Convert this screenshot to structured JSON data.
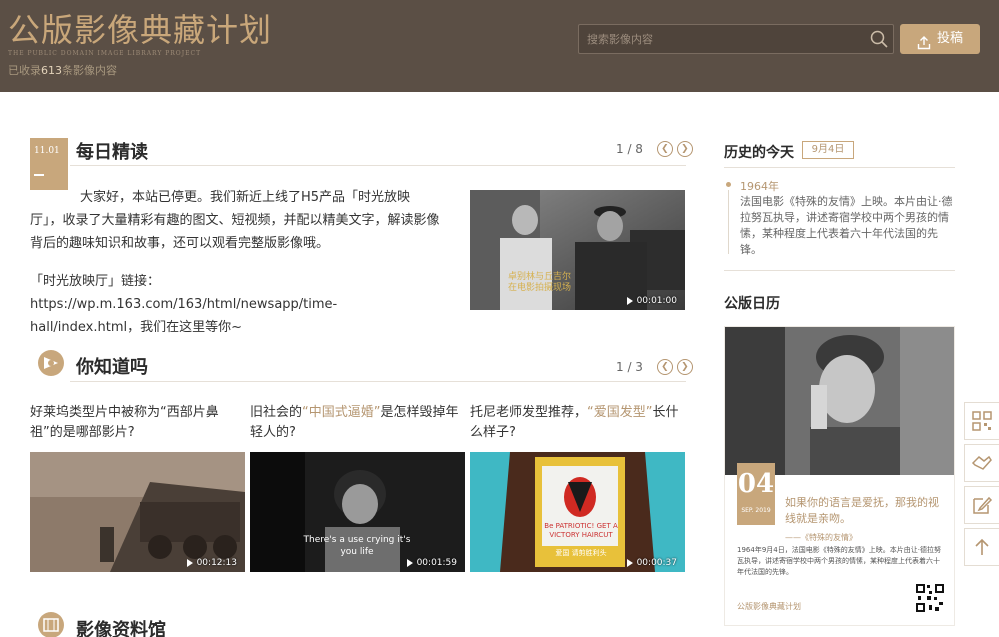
{
  "header": {
    "logo_title": "公版影像典藏计划",
    "logo_subtitle": "THE PUBLIC DOMAIN IMAGE LIBRARY PROJECT",
    "count_prefix": "已收录",
    "count_value": "613",
    "count_suffix": "条影像内容",
    "search_placeholder": "搜索影像内容",
    "upload_label": "投稿",
    "colors": {
      "bar": "#5b4f45",
      "accent": "#c8a77c"
    }
  },
  "daily": {
    "badge_date": "11.01",
    "title": "每日精读",
    "pager": "1 / 8",
    "paragraph1": "大家好，本站已停更。我们新近上线了H5产品「时光放映厅」，收录了大量精彩有趣的图文、短视频，并配以精美文字，解读影像背后的趣味知识和故事，还可以观看完整版影像哦。",
    "paragraph2": "「时光放映厅」链接：https://wp.m.163.com/163/html/newsapp/time-hall/index.html，我们在这里等你~",
    "video_caption": "卓别林与丘吉尔 在电影拍摄现场",
    "video_duration": "00:01:00"
  },
  "dyk": {
    "title": "你知道吗",
    "pager": "1 / 3",
    "items": [
      {
        "text_a": "好莱坞类型片中被称为“西部片鼻祖”的是哪部影片?",
        "hl": "",
        "text_b": "",
        "duration": "00:12:13"
      },
      {
        "text_a": "旧社会的",
        "hl": "“中国式逼婚”",
        "text_b": "是怎样毁掉年轻人的?",
        "duration": "00:01:59",
        "subtitle": "There's a use crying it's you life"
      },
      {
        "text_a": "托尼老师发型推荐，",
        "hl": "“爱国发型”",
        "text_b": "长什么样子?",
        "duration": "00:00:37",
        "sign_text": "Be PATRIOTIC! GET A VICTORY HAIRCUT",
        "sign_cn": "爱国 请剪胜利头"
      }
    ]
  },
  "archive": {
    "title": "影像资料馆"
  },
  "history": {
    "title": "历史的今天",
    "date_tag": "9月4日",
    "year": "1964年",
    "text": "法国电影《特殊的友情》上映。本片由让·德拉努瓦执导，讲述寄宿学校中两个男孩的情愫，某种程度上代表着六十年代法国的先锋。"
  },
  "calendar": {
    "title": "公版日历",
    "day": "04",
    "month": "SEP. 2019",
    "quote": "如果你的语言是爱抚，那我的视线就是亲吻。",
    "source": "——《特殊的友情》",
    "desc": "1964年9月4日，法国电影《特殊的友情》上映。本片由让·德拉努瓦执导，讲述寄宿学校中两个男孩的情愫，某种程度上代表着六十年代法国的先锋。",
    "brand": "公版影像典藏计划"
  },
  "float_tools": {
    "qr_icon": "qr-code-icon",
    "feedback_icon": "handshake-icon",
    "edit_icon": "edit-icon",
    "top_icon": "back-to-top-icon"
  }
}
